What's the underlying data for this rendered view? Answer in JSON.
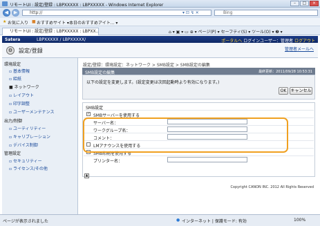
{
  "window": {
    "title": "リモートUI : 設定/登録 : LBPXXXXX : LBPXXXXX - Windows Internet Explorer",
    "buttons": {
      "minimize": "–",
      "maximize": "□",
      "close": "×"
    }
  },
  "browser": {
    "back": "◀",
    "forward": "▶",
    "address": "http://",
    "address_icons": "▾ ⊡ ↯ ✕",
    "search_placeholder": "Bing",
    "favorites_label": "お気に入り",
    "suggested_sites": "おすすめサイト ▾",
    "web_slice": "本日のおすすめアイト... ▾",
    "tab_label": "リモートUI : 設定/登録 : LBPXXXXX : LBPXX...",
    "tools": "⌂ ▾ ▣ ▾ ▭ ⊕ ▾ ページ(P) ▾ セーフティ(S) ▾ ツール(O) ▾ ❷ ▾"
  },
  "app": {
    "brand": "Satera",
    "device": "LBPXXXXX / LBPXXXXX/",
    "portal": "ポータルへ",
    "login_user": "ログインユーザー：管理者",
    "logout": "ログアウト",
    "page_heading": "設定/登録",
    "mgr_link": "管理者メールへ"
  },
  "sidebar": {
    "cat_env": "環境設定",
    "items_env": [
      "基本情報",
      "給紙",
      "ネットワーク",
      "レイアウト",
      "印字調整",
      "ユーザーメンテナンス"
    ],
    "cat_io": "出力/制御",
    "items_io": [
      "ユーティリティー",
      "キャリブレーション",
      "デバイス制御"
    ],
    "cat_mgmt": "管理設定",
    "items_mgmt": [
      "セキュリティー",
      "ライセンス/その他"
    ]
  },
  "main": {
    "breadcrumb": "設定/登録：環境設定：ネットワーク > SMB設定 > SMB設定の編集",
    "section_title": "SMB設定の編集",
    "last_update": "最終更新：2011/09/28 10:53:31",
    "message": "以下の設定を変更します。(設定変更は次回起動時より有効になります。)",
    "ok_label": "OK",
    "cancel_label": "キャンセル",
    "smb_section_title": "SMB設定",
    "use_smb_server": "SMBサーバーを使用する",
    "server_name": "サーバー名：",
    "workgroup_name": "ワークグループ名：",
    "comment": "コメント：",
    "use_lm": "LMアナウンスを使用する",
    "use_smb_print": "SMB印刷を使用する",
    "printer_name": "プリンター名：",
    "up_arrow": "▲",
    "copyright": "Copyright CANON INC. 2012 All Rights Reserved"
  },
  "statusbar": {
    "left": "ページが表示されました",
    "zone": "インターネット | 保護モード: 有効",
    "zoom": "100%"
  }
}
